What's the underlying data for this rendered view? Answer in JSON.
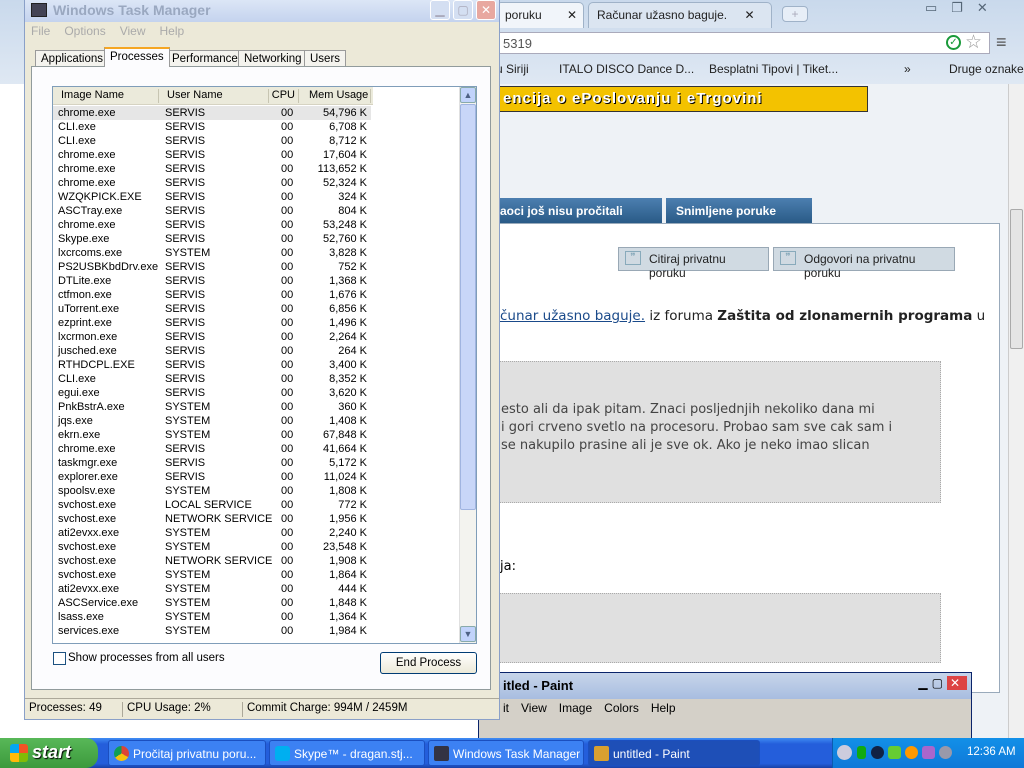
{
  "browser": {
    "tabs": [
      {
        "label": "poruku"
      },
      {
        "label": "Računar užasno baguje."
      }
    ],
    "address": "5319",
    "bookmarks": [
      "u Siriji",
      "ITALO DISCO Dance D...",
      "Besplatni Tipovi | Tiket...",
      "»",
      "Druge oznake"
    ],
    "banner": "encija o ePoslovanju i eTrgovini",
    "page_tabs": [
      "aoci još nisu pročitali",
      "Snimljene poruke"
    ],
    "buttons": {
      "quote": "Citiraj privatnu poruku",
      "reply": "Odgovori na privatnu poruku"
    },
    "topic_link": "čunar užasno baguje.",
    "topic_from": " iz foruma ",
    "forum_name": "Zaštita od zlonamernih programa",
    "topic_tail": " u",
    "quote_lines": [
      "esto ali da ipak pitam. Znaci posljednjih nekoliko dana mi",
      "i gori crveno svetlo na procesoru. Probao sam sve cak sam i",
      "se nakupilo prasine ali je sve ok. Ako je neko imao slican"
    ],
    "sig_label": "ja:"
  },
  "paint": {
    "title": "itled - Paint",
    "menu": [
      "it",
      "View",
      "Image",
      "Colors",
      "Help"
    ]
  },
  "taskmgr": {
    "title": "Windows Task Manager",
    "menu": [
      "File",
      "Options",
      "View",
      "Help"
    ],
    "tabs": [
      "Applications",
      "Processes",
      "Performance",
      "Networking",
      "Users"
    ],
    "columns": [
      "Image Name",
      "User Name",
      "CPU",
      "Mem Usage"
    ],
    "rows": [
      [
        "chrome.exe",
        "SERVIS",
        "00",
        "54,796 K"
      ],
      [
        "CLI.exe",
        "SERVIS",
        "00",
        "6,708 K"
      ],
      [
        "CLI.exe",
        "SERVIS",
        "00",
        "8,712 K"
      ],
      [
        "chrome.exe",
        "SERVIS",
        "00",
        "17,604 K"
      ],
      [
        "chrome.exe",
        "SERVIS",
        "00",
        "113,652 K"
      ],
      [
        "chrome.exe",
        "SERVIS",
        "00",
        "52,324 K"
      ],
      [
        "WZQKPICK.EXE",
        "SERVIS",
        "00",
        "324 K"
      ],
      [
        "ASCTray.exe",
        "SERVIS",
        "00",
        "804 K"
      ],
      [
        "chrome.exe",
        "SERVIS",
        "00",
        "53,248 K"
      ],
      [
        "Skype.exe",
        "SERVIS",
        "00",
        "52,760 K"
      ],
      [
        "lxcrcoms.exe",
        "SYSTEM",
        "00",
        "3,828 K"
      ],
      [
        "PS2USBKbdDrv.exe",
        "SERVIS",
        "00",
        "752 K"
      ],
      [
        "DTLite.exe",
        "SERVIS",
        "00",
        "1,368 K"
      ],
      [
        "ctfmon.exe",
        "SERVIS",
        "00",
        "1,676 K"
      ],
      [
        "uTorrent.exe",
        "SERVIS",
        "00",
        "6,856 K"
      ],
      [
        "ezprint.exe",
        "SERVIS",
        "00",
        "1,496 K"
      ],
      [
        "lxcrmon.exe",
        "SERVIS",
        "00",
        "2,264 K"
      ],
      [
        "jusched.exe",
        "SERVIS",
        "00",
        "264 K"
      ],
      [
        "RTHDCPL.EXE",
        "SERVIS",
        "00",
        "3,400 K"
      ],
      [
        "CLI.exe",
        "SERVIS",
        "00",
        "8,352 K"
      ],
      [
        "egui.exe",
        "SERVIS",
        "00",
        "3,620 K"
      ],
      [
        "PnkBstrA.exe",
        "SYSTEM",
        "00",
        "360 K"
      ],
      [
        "jqs.exe",
        "SYSTEM",
        "00",
        "1,408 K"
      ],
      [
        "ekrn.exe",
        "SYSTEM",
        "00",
        "67,848 K"
      ],
      [
        "chrome.exe",
        "SERVIS",
        "00",
        "41,664 K"
      ],
      [
        "taskmgr.exe",
        "SERVIS",
        "00",
        "5,172 K"
      ],
      [
        "explorer.exe",
        "SERVIS",
        "00",
        "11,024 K"
      ],
      [
        "spoolsv.exe",
        "SYSTEM",
        "00",
        "1,808 K"
      ],
      [
        "svchost.exe",
        "LOCAL SERVICE",
        "00",
        "772 K"
      ],
      [
        "svchost.exe",
        "NETWORK SERVICE",
        "00",
        "1,956 K"
      ],
      [
        "ati2evxx.exe",
        "SYSTEM",
        "00",
        "2,240 K"
      ],
      [
        "svchost.exe",
        "SYSTEM",
        "00",
        "23,548 K"
      ],
      [
        "svchost.exe",
        "NETWORK SERVICE",
        "00",
        "1,908 K"
      ],
      [
        "svchost.exe",
        "SYSTEM",
        "00",
        "1,864 K"
      ],
      [
        "ati2evxx.exe",
        "SYSTEM",
        "00",
        "444 K"
      ],
      [
        "ASCService.exe",
        "SYSTEM",
        "00",
        "1,848 K"
      ],
      [
        "lsass.exe",
        "SYSTEM",
        "00",
        "1,364 K"
      ],
      [
        "services.exe",
        "SYSTEM",
        "00",
        "1,984 K"
      ]
    ],
    "show_all_label": "Show processes from all users",
    "show_all_checked": false,
    "end_process": "End Process",
    "status": {
      "processes": "Processes: 49",
      "cpu": "CPU Usage: 2%",
      "commit": "Commit Charge: 994M / 2459M"
    }
  },
  "taskbar": {
    "start": "start",
    "tasks": [
      "Pročitaj privatnu poru...",
      "Skype™ - dragan.stj...",
      "Windows Task Manager",
      "untitled - Paint"
    ],
    "clock": "12:36 AM"
  }
}
